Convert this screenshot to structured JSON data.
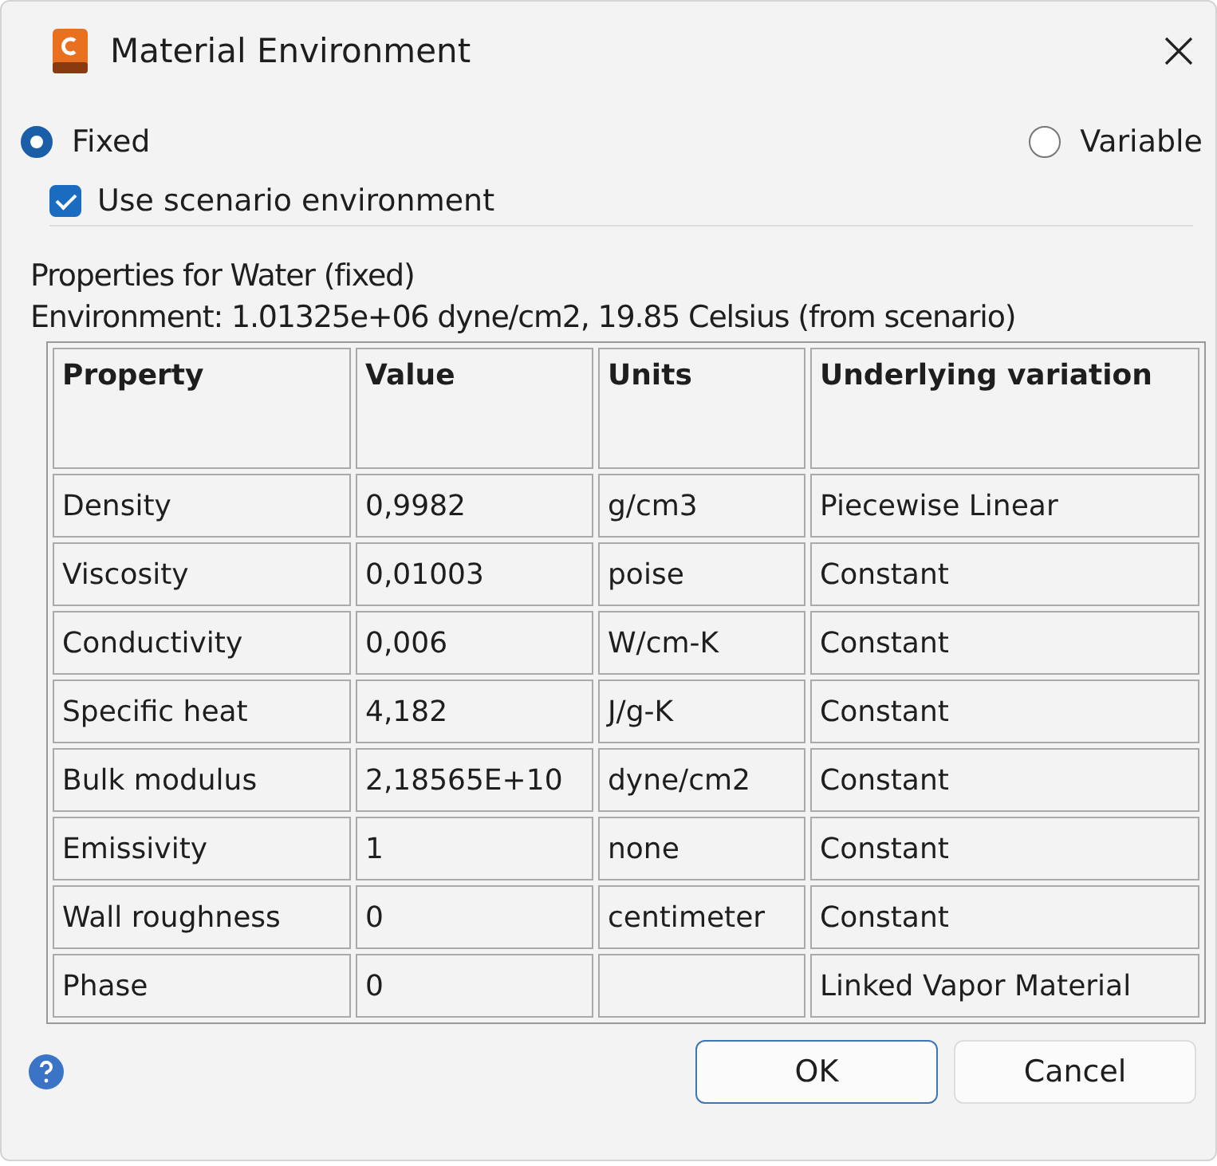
{
  "window": {
    "title": "Material Environment"
  },
  "mode_options": [
    {
      "label": "Fixed",
      "selected": true
    },
    {
      "label": "Variable",
      "selected": false
    }
  ],
  "use_scenario": {
    "label": "Use scenario environment",
    "checked": true
  },
  "properties_heading": "Properties for Water (fixed)",
  "environment_line": "Environment: 1.01325e+06 dyne/cm2, 19.85 Celsius (from scenario)",
  "table": {
    "columns": [
      "Property",
      "Value",
      "Units",
      "Underlying variation"
    ],
    "rows": [
      [
        "Density",
        "0,9982",
        "g/cm3",
        "Piecewise Linear"
      ],
      [
        "Viscosity",
        "0,01003",
        "poise",
        "Constant"
      ],
      [
        "Conductivity",
        "0,006",
        "W/cm-K",
        "Constant"
      ],
      [
        "Specific heat",
        "4,182",
        "J/g-K",
        "Constant"
      ],
      [
        "Bulk modulus",
        "2,18565E+10",
        "dyne/cm2",
        "Constant"
      ],
      [
        "Emissivity",
        "1",
        "none",
        "Constant"
      ],
      [
        "Wall roughness",
        "0",
        "centimeter",
        "Constant"
      ],
      [
        "Phase",
        "0",
        "",
        "Linked Vapor Material"
      ]
    ]
  },
  "buttons": [
    {
      "label": "OK",
      "kind": "default"
    },
    {
      "label": "Cancel",
      "kind": "normal"
    }
  ]
}
